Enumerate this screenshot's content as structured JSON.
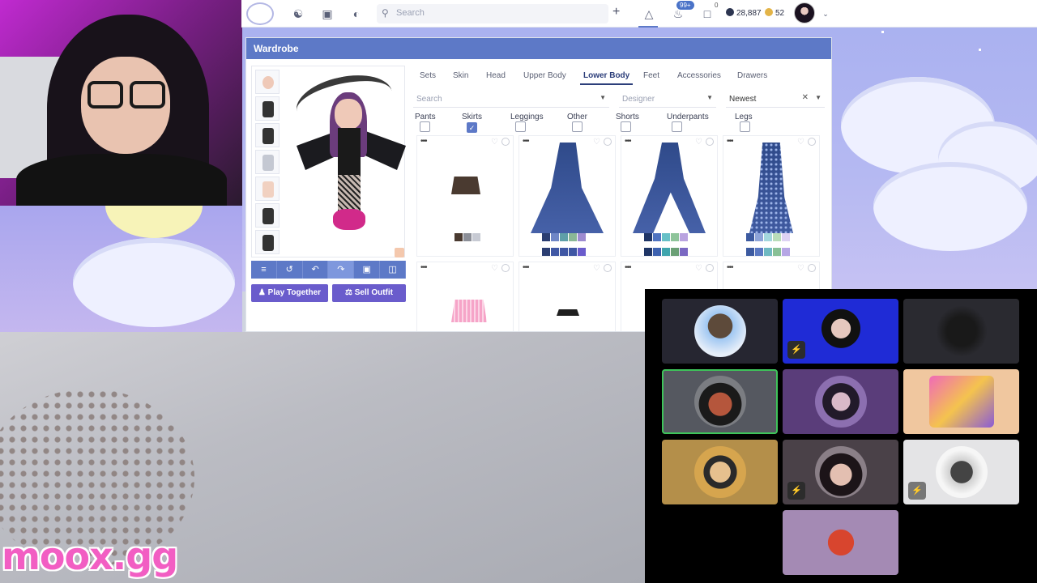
{
  "topbar": {
    "search_placeholder": "Search",
    "notif_badge": "99+",
    "chat_badge": "0",
    "gems": "28,887",
    "coins": "52"
  },
  "wardrobe": {
    "title": "Wardrobe",
    "tabs": [
      "Sets",
      "Skin",
      "Head",
      "Upper Body",
      "Lower Body",
      "Feet",
      "Accessories",
      "Drawers"
    ],
    "active_tab": "Lower Body",
    "search_placeholder": "Search",
    "designer_placeholder": "Designer",
    "sort_value": "Newest",
    "checkboxes": [
      {
        "label": "Pants",
        "checked": false
      },
      {
        "label": "Skirts",
        "checked": true
      },
      {
        "label": "Leggings",
        "checked": false
      },
      {
        "label": "Other",
        "checked": false
      },
      {
        "label": "Shorts",
        "checked": false
      },
      {
        "label": "Underpants",
        "checked": false
      },
      {
        "label": "Legs",
        "checked": false
      }
    ],
    "play_together": "Play Together",
    "sell_outfit": "Sell Outfit",
    "colors": {
      "header": "#5d79c7",
      "button": "#6a5ccc"
    }
  },
  "brand": "moox.gg",
  "icons": [
    "logo-icon",
    "community-icon",
    "shop-icon",
    "gamepad-icon",
    "search-icon",
    "plus-icon",
    "wardrobe-icon",
    "bell-icon",
    "chat-icon",
    "gem-icon",
    "coin-icon",
    "chevron-down-icon",
    "mic-off-icon"
  ]
}
